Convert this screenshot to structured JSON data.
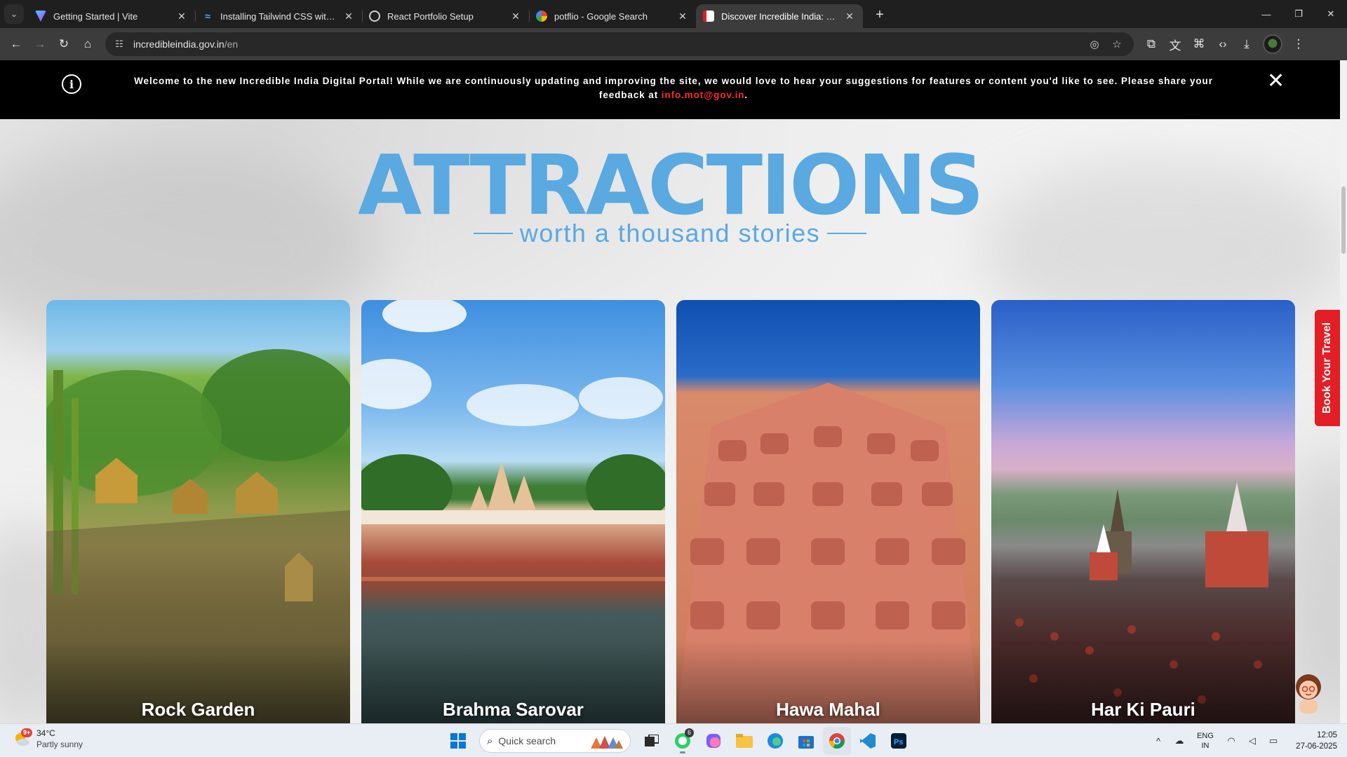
{
  "browser": {
    "tabs": [
      {
        "title": "Getting Started | Vite",
        "favicon_color": "#8f5cff",
        "active": false
      },
      {
        "title": "Installing Tailwind CSS with Vite",
        "favicon_color": "#38bdf8",
        "active": false
      },
      {
        "title": "React Portfolio Setup",
        "favicon_color": "#d0d0d0",
        "active": false
      },
      {
        "title": "potflio - Google Search",
        "favicon_color": "#4285f4",
        "active": false
      },
      {
        "title": "Discover Incredible India: Travel",
        "favicon_color": "#e31e24",
        "active": true
      }
    ],
    "url_host": "incredibleindia.gov.in",
    "url_path": "/en"
  },
  "banner": {
    "message": "Welcome to the new Incredible India Digital Portal! While we are continuously updating and improving the site, we would love to hear your suggestions for features or content you'd like to see. Please share your feedback at",
    "email": "info.mot@gov.in",
    "period": "."
  },
  "section": {
    "heading": "ATTRACTIONS",
    "subheading": "worth a thousand stories",
    "accent_color": "#5aa9e0"
  },
  "cards": [
    {
      "name": "Rock Garden"
    },
    {
      "name": "Brahma Sarovar"
    },
    {
      "name": "Hawa Mahal"
    },
    {
      "name": "Har Ki Pauri"
    }
  ],
  "book_tab": {
    "label": "Book Your Travel",
    "color": "#e31e24"
  },
  "taskbar": {
    "weather_badge": "9+",
    "temperature": "34°C",
    "condition": "Partly sunny",
    "search_placeholder": "Quick search",
    "whatsapp_badge": "6",
    "lang_top": "ENG",
    "lang_bottom": "IN",
    "time": "12:05",
    "date": "27-06-2025"
  }
}
